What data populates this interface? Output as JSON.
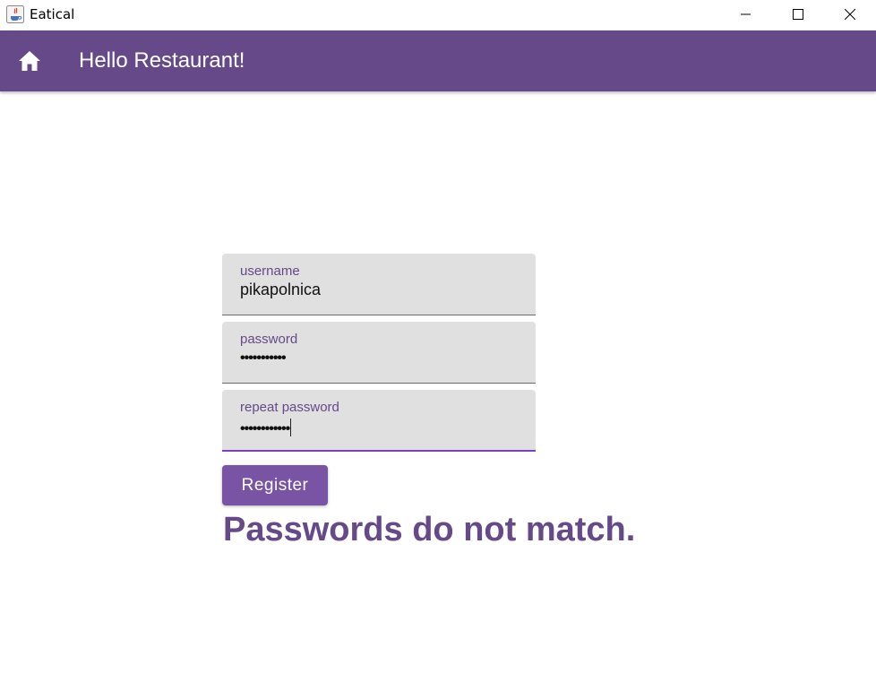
{
  "window": {
    "title": "Eatical"
  },
  "appbar": {
    "title": "Hello Restaurant!",
    "home_icon": "home-icon",
    "color": "#664988"
  },
  "form": {
    "username": {
      "label": "username",
      "value": "pikapolnica"
    },
    "password": {
      "label": "password",
      "value": "•••••••••••"
    },
    "repeat_password": {
      "label": "repeat password",
      "value": "••••••••••••"
    },
    "register_label": "Register",
    "error_message": "Passwords do not match."
  },
  "colors": {
    "accent": "#664988",
    "button": "#7a54a4",
    "focus_underline": "#7e3fc2",
    "field_bg": "#e0e0e0"
  }
}
